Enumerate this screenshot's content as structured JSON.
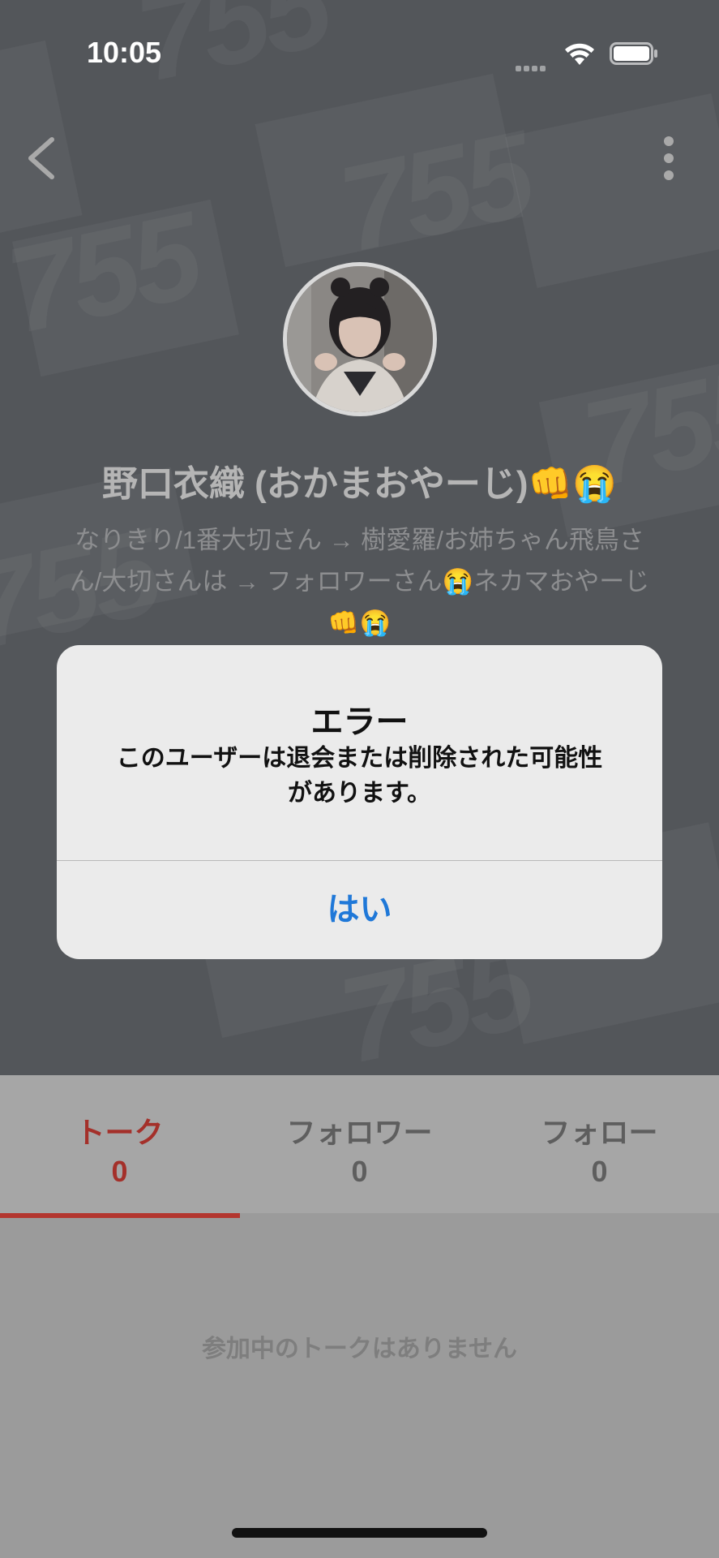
{
  "status_bar": {
    "time": "10:05"
  },
  "profile": {
    "display_name": "野口衣織 (おかまおやーじ)👊😭",
    "bio": "なりきり/1番大切さん → 樹愛羅/お姉ちゃん飛鳥さん/大切さんは → フォロワーさん😭ネカマおやーじ👊😭",
    "background_pattern_text": "755"
  },
  "tabs": [
    {
      "label": "トーク",
      "count": "0",
      "active": true
    },
    {
      "label": "フォロワー",
      "count": "0",
      "active": false
    },
    {
      "label": "フォロー",
      "count": "0",
      "active": false
    }
  ],
  "empty_message": "参加中のトークはありません",
  "alert": {
    "title": "エラー",
    "message": "このユーザーは退会または削除された可能性があります。",
    "button_label": "はい"
  },
  "colors": {
    "accent": "#b3362f",
    "alert_button": "#1f78d8"
  },
  "icons": {
    "back": "chevron-left-icon",
    "more": "vertical-ellipsis-icon",
    "wifi": "wifi-icon",
    "battery": "battery-icon",
    "signal": "cellular-signal-icon"
  }
}
